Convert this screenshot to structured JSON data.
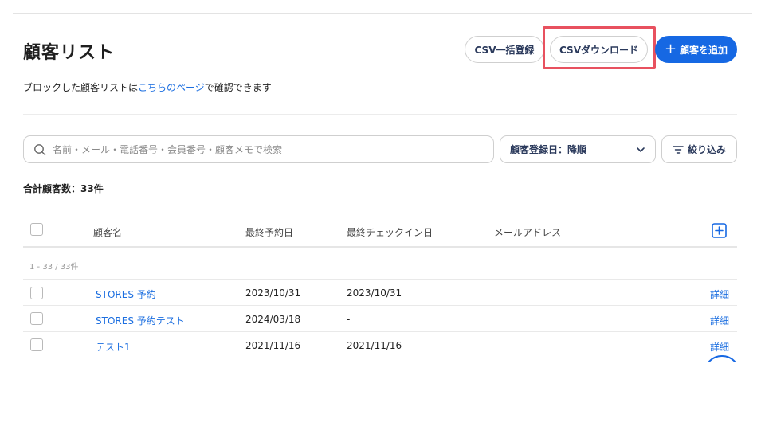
{
  "page": {
    "title": "顧客リスト",
    "subtitle_prefix": "ブロックした顧客リストは",
    "subtitle_link": "こちらのページ",
    "subtitle_suffix": "で確認できます"
  },
  "actions": {
    "csv_import_label": "CSV一括登録",
    "csv_download_label": "CSVダウンロード",
    "add_customer_label": "顧客を追加",
    "add_customer_icon": "plus-icon"
  },
  "filters": {
    "search_placeholder": "名前・メール・電話番号・会員番号・顧客メモで検索",
    "search_value": "",
    "sort_label": "顧客登録日：降順",
    "filter_label": "絞り込み"
  },
  "summary": {
    "total_label": "合計顧客数：33件",
    "range_label": "1 - 33 / 33件"
  },
  "table": {
    "columns": [
      "顧客名",
      "最終予約日",
      "最終チェックイン日",
      "メールアドレス"
    ],
    "detail_label": "詳細",
    "rows": [
      {
        "name": "STORES 予約",
        "last_booking": "2023/10/31",
        "last_checkin": "2023/10/31",
        "email": ""
      },
      {
        "name": "STORES 予約テスト",
        "last_booking": "2024/03/18",
        "last_checkin": "-",
        "email": ""
      },
      {
        "name": "テスト1",
        "last_booking": "2021/11/16",
        "last_checkin": "2021/11/16",
        "email": ""
      }
    ]
  },
  "colors": {
    "primary": "#1668e3",
    "link": "#1d6fe0",
    "highlight": "#e8515f"
  }
}
